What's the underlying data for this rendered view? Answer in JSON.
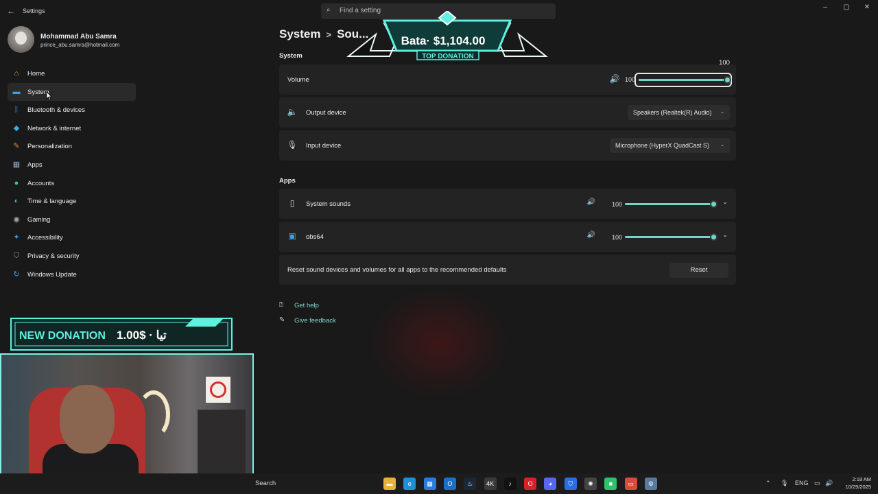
{
  "window": {
    "title": "Settings",
    "search_placeholder": "Find a setting",
    "controls": {
      "minimize": "–",
      "maximize": "▢",
      "close": "✕"
    }
  },
  "profile": {
    "name": "Mohammad Abu Samra",
    "email": "prince_abu.samra@hotmail.com"
  },
  "sidebar": {
    "items": [
      {
        "label": "Home",
        "icon": "home-icon",
        "color": "#e8a54b"
      },
      {
        "label": "System",
        "icon": "monitor-icon",
        "color": "#3aa0e8",
        "active": true
      },
      {
        "label": "Bluetooth & devices",
        "icon": "bluetooth-icon",
        "color": "#3a8fe8"
      },
      {
        "label": "Network & internet",
        "icon": "wifi-icon",
        "color": "#3ab0e8"
      },
      {
        "label": "Personalization",
        "icon": "brush-icon",
        "color": "#e8883a"
      },
      {
        "label": "Apps",
        "icon": "apps-icon",
        "color": "#8fa8c8"
      },
      {
        "label": "Accounts",
        "icon": "person-icon",
        "color": "#2ec98f"
      },
      {
        "label": "Time & language",
        "icon": "globe-clock-icon",
        "color": "#3ab0e8"
      },
      {
        "label": "Gaming",
        "icon": "gamepad-icon",
        "color": "#9ca3ad"
      },
      {
        "label": "Accessibility",
        "icon": "accessibility-icon",
        "color": "#3a9ae8"
      },
      {
        "label": "Privacy & security",
        "icon": "shield-icon",
        "color": "#9ca3ad"
      },
      {
        "label": "Windows Update",
        "icon": "update-icon",
        "color": "#3aa0e8"
      }
    ]
  },
  "breadcrumb": {
    "parent": "System",
    "separator": ">",
    "current": "Sou..."
  },
  "sections": {
    "system": "System",
    "apps": "Apps"
  },
  "volume": {
    "label": "Volume",
    "value": "100",
    "tooltip": "100",
    "level": 1.0
  },
  "output_device": {
    "label": "Output device",
    "selected": "Speakers (Realtek(R) Audio)"
  },
  "input_device": {
    "label": "Input device",
    "selected": "Microphone (HyperX QuadCast S)"
  },
  "apps": [
    {
      "label": "System sounds",
      "value": "100",
      "level": 1.0
    },
    {
      "label": "obs64",
      "value": "100",
      "level": 1.0
    }
  ],
  "reset": {
    "text": "Reset sound devices and volumes for all apps to the recommended defaults",
    "button": "Reset"
  },
  "help": {
    "get_help": "Get help",
    "give_feedback": "Give feedback"
  },
  "overlays": {
    "top_donation": {
      "amount": "Bata· $1,104.00",
      "label": "TOP DONATION"
    },
    "new_donation": {
      "label": "NEW DONATION",
      "amount": "1.00$ · تيا"
    }
  },
  "taskbar": {
    "search": "Search",
    "lang": "ENG",
    "time": "2:18 AM",
    "date": "10/29/2025",
    "apps": [
      {
        "name": "file-explorer-icon",
        "color": "#e8b23a"
      },
      {
        "name": "edge-icon",
        "color": "#1f8fd8"
      },
      {
        "name": "store-icon",
        "color": "#2a7be0"
      },
      {
        "name": "outlook-icon",
        "color": "#1a6fc8"
      },
      {
        "name": "steam-icon",
        "color": "#1b2838"
      },
      {
        "name": "4k-icon",
        "color": "#3a3a3a"
      },
      {
        "name": "tiktok-icon",
        "color": "#111111"
      },
      {
        "name": "opera-icon",
        "color": "#d8202a"
      },
      {
        "name": "discord-icon",
        "color": "#5865f2"
      },
      {
        "name": "vpn-icon",
        "color": "#2a6fe0"
      },
      {
        "name": "chatgpt-icon",
        "color": "#444444"
      },
      {
        "name": "app-green-icon",
        "color": "#2ec26a"
      },
      {
        "name": "app-red-icon",
        "color": "#d84a3a"
      },
      {
        "name": "settings-icon",
        "color": "#5a7a9a"
      }
    ]
  }
}
